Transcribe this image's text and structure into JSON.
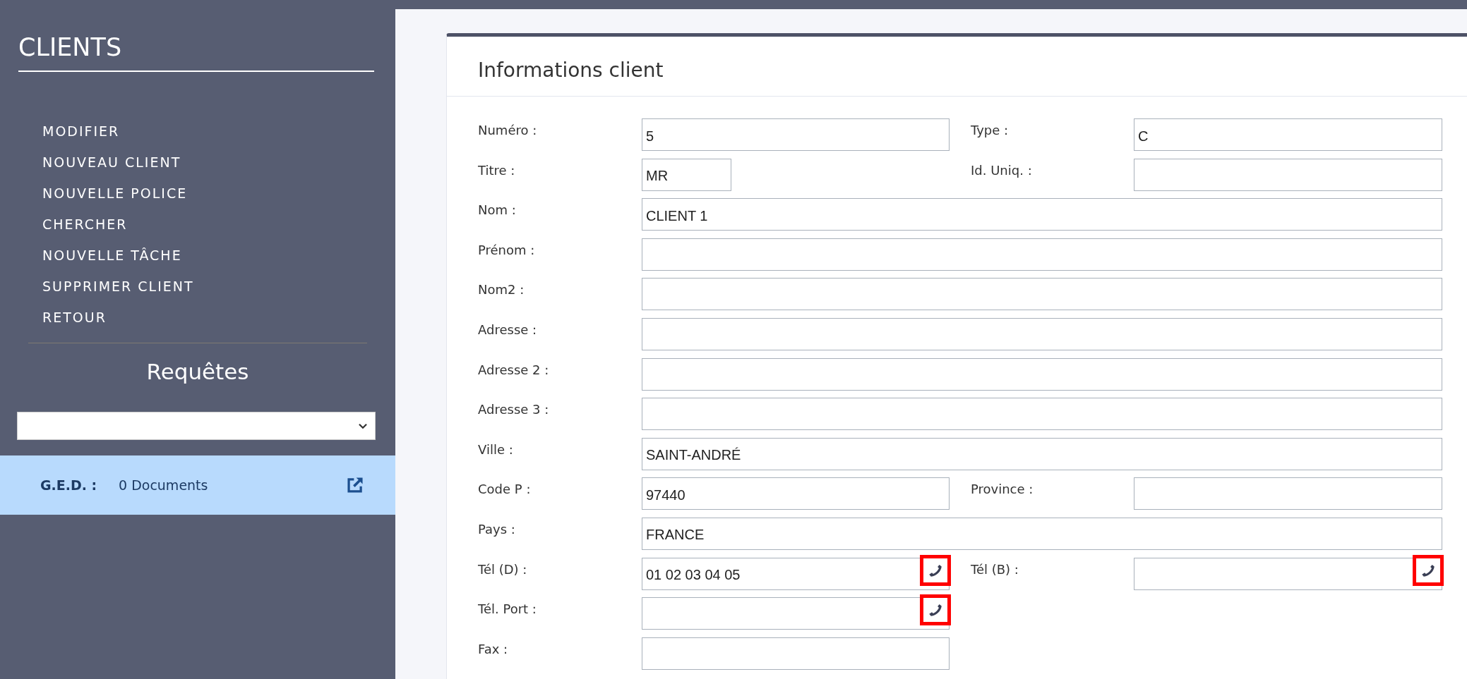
{
  "sidebar": {
    "title": "CLIENTS",
    "menu": [
      {
        "label": "MODIFIER"
      },
      {
        "label": "NOUVEAU CLIENT"
      },
      {
        "label": "NOUVELLE POLICE"
      },
      {
        "label": "CHERCHER"
      },
      {
        "label": "NOUVELLE TÂCHE"
      },
      {
        "label": "SUPPRIMER CLIENT"
      },
      {
        "label": "RETOUR"
      }
    ],
    "queries": {
      "heading": "Requêtes"
    },
    "ged": {
      "label": "G.E.D. :",
      "count": "0 Documents"
    }
  },
  "card": {
    "title": "Informations client",
    "rows": [
      {
        "fields": [
          {
            "label": "Numéro :",
            "value": "5",
            "kind": "half"
          },
          {
            "label": "Type :",
            "value": "C",
            "kind": "half"
          }
        ]
      },
      {
        "fields": [
          {
            "label": "Titre :",
            "value": "MR",
            "kind": "short"
          },
          {
            "label": "Id. Uniq. :",
            "kind": "half"
          }
        ]
      },
      {
        "fields": [
          {
            "label": "Nom :",
            "value": "CLIENT 1",
            "kind": "full"
          }
        ]
      },
      {
        "fields": [
          {
            "label": "Prénom :",
            "kind": "full"
          }
        ]
      },
      {
        "fields": [
          {
            "label": "Nom2 :",
            "kind": "full"
          }
        ]
      },
      {
        "fields": [
          {
            "label": "Adresse :",
            "kind": "full"
          }
        ]
      },
      {
        "fields": [
          {
            "label": "Adresse 2 :",
            "kind": "full"
          }
        ]
      },
      {
        "fields": [
          {
            "label": "Adresse 3 :",
            "kind": "full"
          }
        ]
      },
      {
        "fields": [
          {
            "label": "Ville :",
            "value": "SAINT-ANDRÉ",
            "kind": "full"
          }
        ]
      },
      {
        "fields": [
          {
            "label": "Code P :",
            "value": "97440",
            "kind": "half"
          },
          {
            "label": "Province :",
            "kind": "half"
          }
        ]
      },
      {
        "fields": [
          {
            "label": "Pays :",
            "value": "FRANCE",
            "kind": "full"
          }
        ]
      },
      {
        "fields": [
          {
            "label": "Tél (D) :",
            "value": "01 02 03 04 05",
            "kind": "phone"
          },
          {
            "label": "Tél (B) :",
            "kind": "phone"
          }
        ]
      },
      {
        "fields": [
          {
            "label": "Tél. Port :",
            "kind": "phone"
          }
        ]
      },
      {
        "fields": [
          {
            "label": "Fax :",
            "kind": "half"
          }
        ]
      }
    ]
  }
}
